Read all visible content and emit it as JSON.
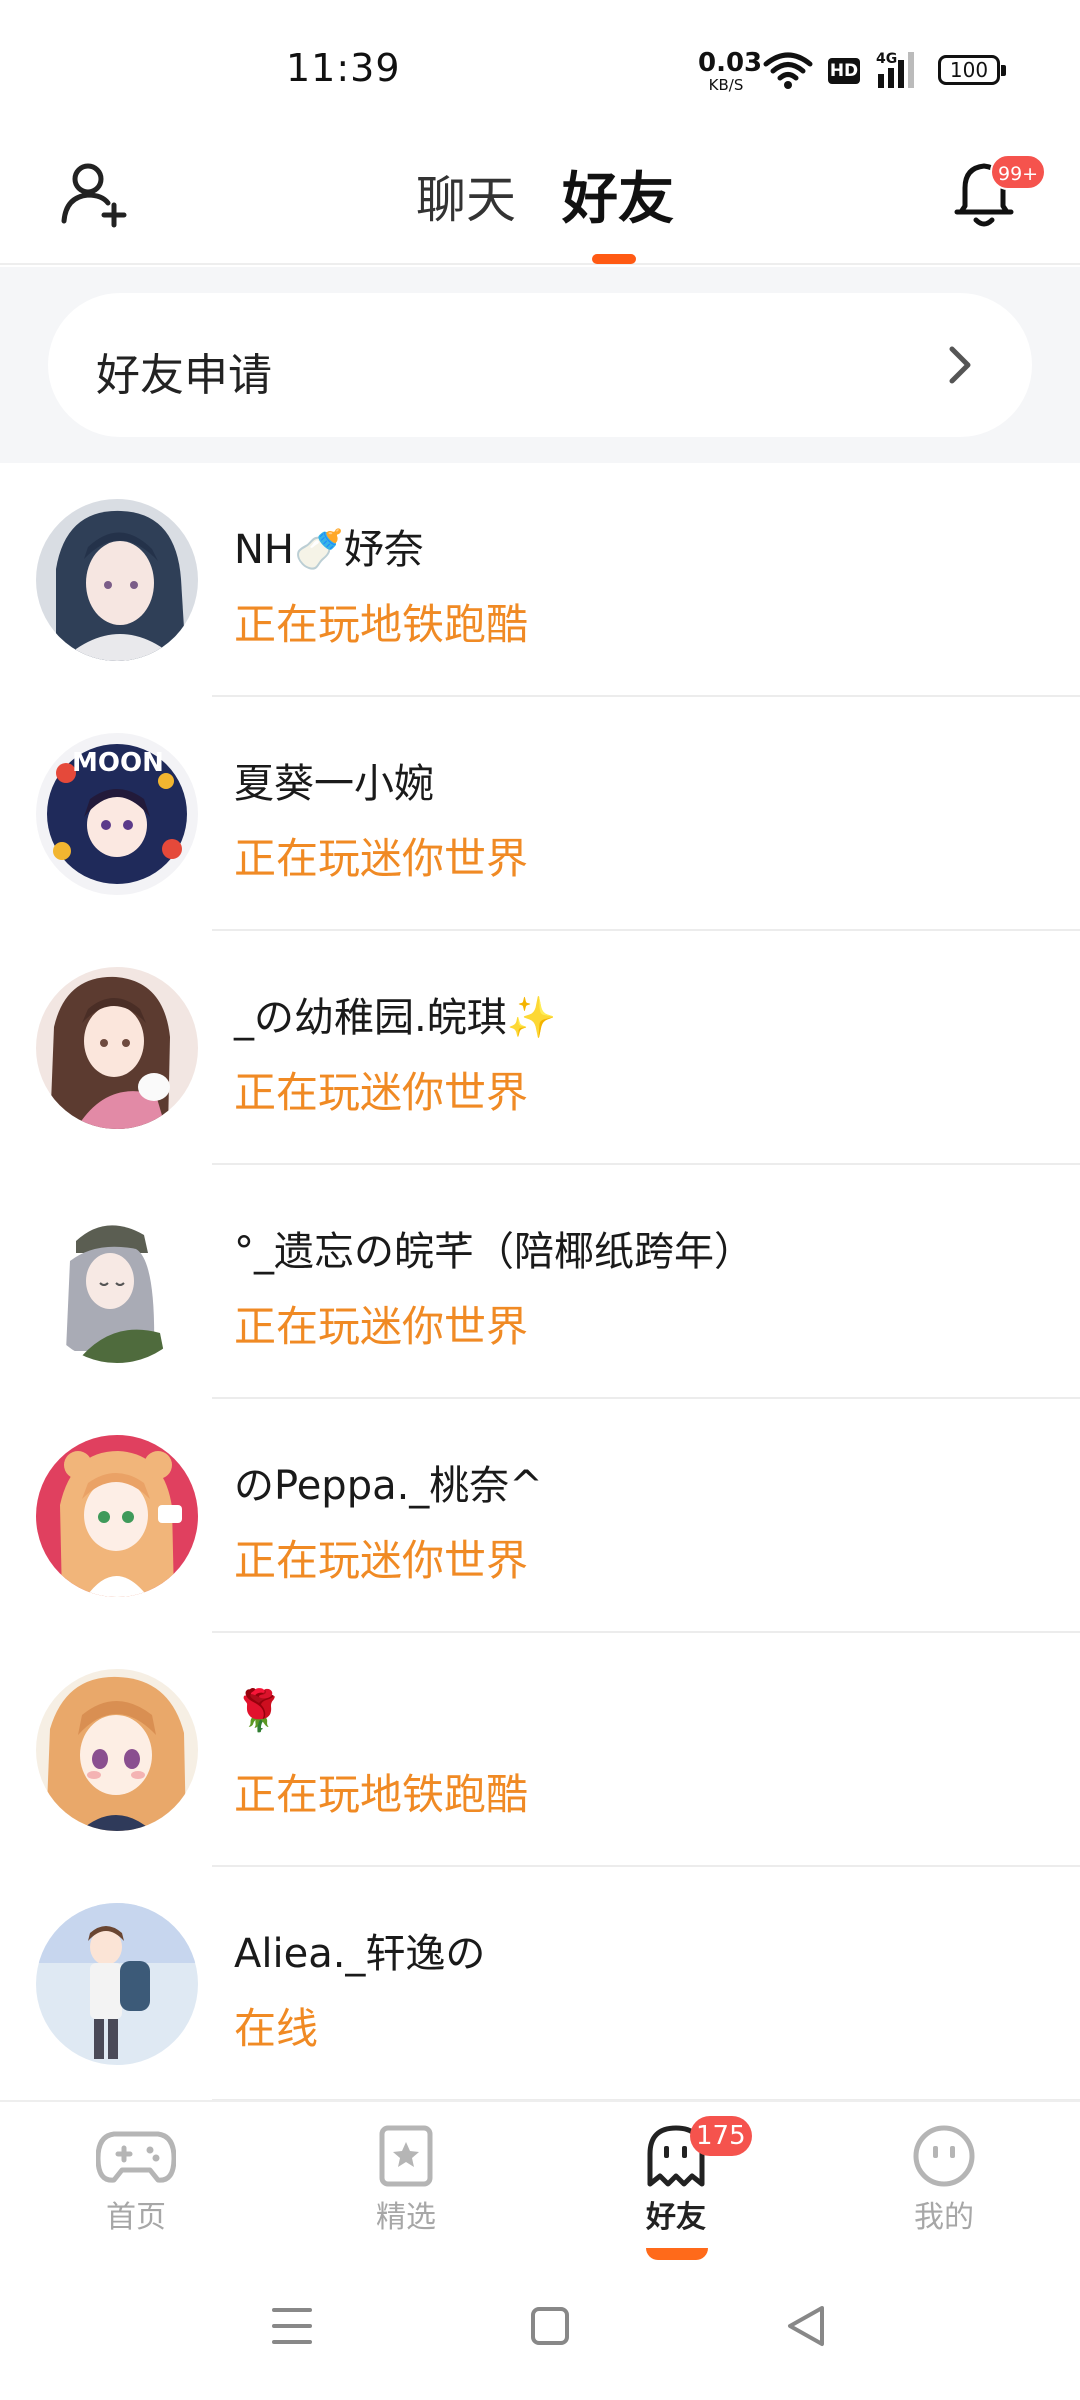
{
  "status_bar": {
    "time": "11:39",
    "net_speed_value": "0.03",
    "net_speed_unit": "KB/S",
    "hd_label": "HD",
    "signal_label": "4G",
    "battery": "100"
  },
  "header": {
    "tabs": [
      {
        "label": "聊天",
        "active": false
      },
      {
        "label": "好友",
        "active": true
      }
    ],
    "notification_badge": "99+",
    "accent_color": "#ff5a14"
  },
  "friend_request": {
    "label": "好友申请"
  },
  "friends": [
    {
      "name": "NH🍼妤奈",
      "status": "正在玩地铁跑酷",
      "avatar_icon": "anime-girl-blue-hair-avatar"
    },
    {
      "name": "夏葵一小婉",
      "status": "正在玩迷你世界",
      "avatar_icon": "anime-girl-moon-avatar"
    },
    {
      "name": "_の幼稚园.皖琪✨",
      "status": "正在玩迷你世界",
      "avatar_icon": "anime-girl-cat-avatar"
    },
    {
      "name": "°_遗忘の皖芊（陪椰纸跨年）",
      "status": "正在玩迷你世界",
      "avatar_icon": "anime-girl-grey-hair-avatar"
    },
    {
      "name": "のPeppa._桃奈^",
      "status": "正在玩迷你世界",
      "avatar_icon": "anime-girl-pink-bg-avatar"
    },
    {
      "name": "🌹",
      "status": "正在玩地铁跑酷",
      "avatar_icon": "anime-girl-orange-hair-avatar"
    },
    {
      "name": "Aliea._轩逸の",
      "status": "在线",
      "avatar_icon": "anime-boy-backpack-avatar"
    }
  ],
  "status_color": "#f08a24",
  "bottom_nav": [
    {
      "label": "首页",
      "icon": "gamepad-icon",
      "active": false
    },
    {
      "label": "精选",
      "icon": "star-card-icon",
      "active": false
    },
    {
      "label": "好友",
      "icon": "ghost-icon",
      "active": true,
      "badge": "175"
    },
    {
      "label": "我的",
      "icon": "face-icon",
      "active": false
    }
  ]
}
